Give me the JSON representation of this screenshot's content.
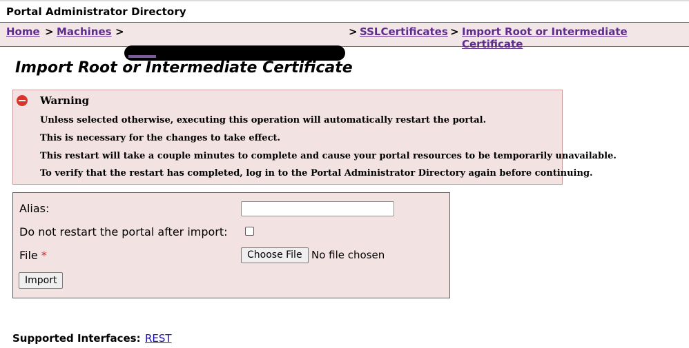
{
  "app_title": "Portal Administrator Directory",
  "breadcrumb": {
    "items": [
      {
        "label": "Home"
      },
      {
        "label": "Machines"
      },
      {
        "label": "SSLCertificates"
      },
      {
        "label": "Import Root or Intermediate Certificate"
      }
    ],
    "separator": ">"
  },
  "page_title": "Import Root or Intermediate Certificate",
  "warning": {
    "heading": "Warning",
    "lines": [
      "Unless selected otherwise, executing this operation will automatically restart the portal.",
      "This is necessary for the changes to take effect.",
      "This restart will take a couple minutes to complete and cause your portal resources to be temporarily unavailable.",
      "To verify that the restart has completed, log in to the Portal Administrator Directory again before continuing."
    ]
  },
  "form": {
    "alias_label": "Alias:",
    "alias_value": "",
    "no_restart_label": "Do not restart the portal after import:",
    "no_restart_checked": false,
    "file_label": "File",
    "required_marker": "*",
    "choose_file_label": "Choose File",
    "file_status": "No file chosen",
    "import_label": "Import"
  },
  "footer": {
    "supported_label": "Supported Interfaces:",
    "rest_link": "REST"
  },
  "colors": {
    "link": "#5e2c8c",
    "panel_bg": "#f2e2e2",
    "warning_icon": "#d9352a",
    "required": "#d42b2b"
  },
  "icons": {
    "warning": "warning-icon"
  }
}
